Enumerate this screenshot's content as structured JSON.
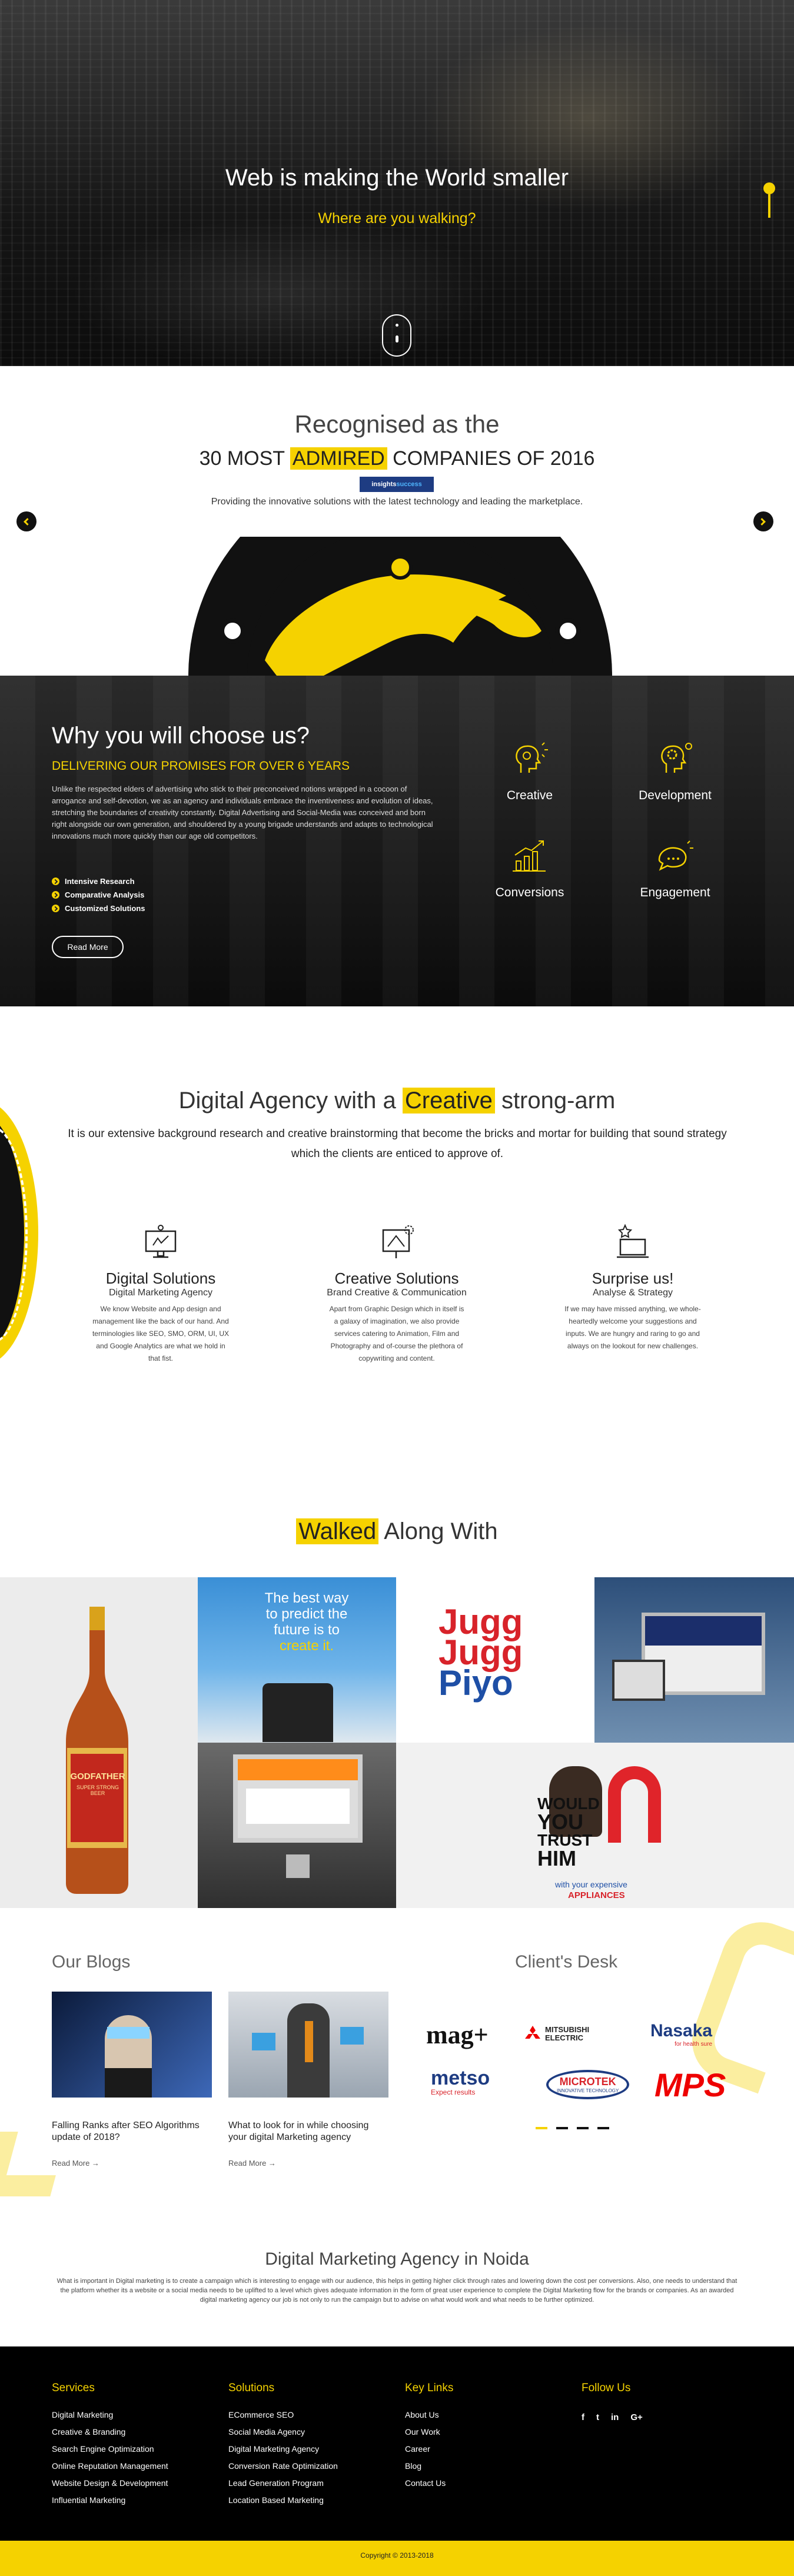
{
  "hero": {
    "title": "Web is making the World smaller",
    "subtitle": "Where are you walking?",
    "scroll_icon": "mouse-scroll-icon"
  },
  "recognition": {
    "line1": "Recognised as the",
    "pre": "30 MOST ",
    "highlight": "ADMIRED",
    "post": " COMPANIES OF 2016",
    "badge_a": "insights",
    "badge_b": "success",
    "description": "Providing the innovative solutions with the latest technology and leading the marketplace.",
    "prev_icon": "chevron-left-icon",
    "next_icon": "chevron-right-icon"
  },
  "why": {
    "title": "Why you will choose us?",
    "tagline": "DELIVERING OUR PROMISES FOR OVER 6 YEARS",
    "body": "Unlike the respected elders of advertising who stick to their preconceived notions wrapped in a cocoon of arrogance and self-devotion, we as an agency and individuals embrace the inventiveness and evolution of ideas, stretching the boundaries of creativity constantly. Digital Advertising and Social-Media was conceived and born right alongside our own generation, and shouldered by a young brigade understands and adapts to technological innovations much more quickly than our age old competitors.",
    "bullets": [
      "Intensive Research",
      "Comparative Analysis",
      "Customized Solutions"
    ],
    "button": "Read More",
    "features": [
      "Creative",
      "Development",
      "Conversions",
      "Engagement"
    ]
  },
  "agency": {
    "pre": "Digital Agency with a ",
    "highlight": "Creative",
    "post": " strong-arm",
    "description": "It is our extensive background research and creative brainstorming that become the bricks and mortar for building that sound strategy which the clients are enticed to approve of.",
    "services": [
      {
        "title": "Digital Solutions",
        "subtitle": "Digital Marketing Agency",
        "text": "We know Website and App design and management like the back of our hand. And terminologies like SEO, SMO, ORM, UI, UX and Google Analytics are what we hold in that fist."
      },
      {
        "title": "Creative Solutions",
        "subtitle": "Brand Creative & Communication",
        "text": "Apart from Graphic Design which in itself is a galaxy of imagination, we also provide services catering to Animation, Film and Photography and of-course the plethora of copywriting and content."
      },
      {
        "title": "Surprise us!",
        "subtitle": "Analyse & Strategy",
        "text": "If we may have missed anything, we whole-heartedly welcome your suggestions and inputs. We are hungry and raring to go and always on the lookout for new challenges."
      }
    ]
  },
  "walked": {
    "highlight": "Walked",
    "post": " Along With"
  },
  "portfolio": {
    "beer_label": "GODFATHER",
    "beer_sub": "SUPER STRONG BEER",
    "predict": [
      "The best way",
      "to predict the",
      "future is to",
      "create it."
    ],
    "jugg1": "Jugg",
    "jugg2": "Jugg",
    "jugg3": "Piyo",
    "would": [
      "WOULD",
      "YOU",
      "TRUST",
      "HIM"
    ],
    "with": "with your expensive",
    "appliances": "APPLIANCES"
  },
  "blogs": {
    "title": "Our Blogs",
    "posts": [
      {
        "title": "Falling Ranks after SEO Algorithms update of 2018?",
        "link": "Read More →"
      },
      {
        "title": "What to look for in while choosing your digital Marketing agency",
        "link": "Read More →"
      }
    ]
  },
  "clients": {
    "title": "Client's Desk",
    "logos": [
      "mag+",
      "MITSUBISHI ELECTRIC",
      "Nasaka",
      "metso",
      "MICROTEK",
      "MPS"
    ],
    "nasaka_sub": "for health sure",
    "metso_sub": "Expect results",
    "microtek_sub": "INNOVATIVE TECHNOLOGY"
  },
  "noida": {
    "title": "Digital Marketing Agency in Noida",
    "text": "What is important in Digital marketing is to create a campaign which is interesting to engage with our audience, this helps in getting higher click through rates and lowering down the cost per conversions. Also, one needs to understand that the platform whether its a website or a social media needs to be uplifted to a level which gives adequate information in the form of great user experience to complete the Digital Marketing flow for the brands or companies. As an awarded digital marketing agency our job is not only to run the campaign but to advise on what would work and what needs to be further optimized."
  },
  "footer": {
    "services": {
      "title": "Services",
      "items": [
        "Digital Marketing",
        "Creative & Branding",
        "Search Engine Optimization",
        "Online Reputation Management",
        "Website Design & Development",
        "Influential Marketing"
      ]
    },
    "solutions": {
      "title": "Solutions",
      "items": [
        "ECommerce SEO",
        "Social Media Agency",
        "Digital Marketing Agency",
        "Conversion Rate Optimization",
        "Lead Generation Program",
        "Location Based Marketing"
      ]
    },
    "links": {
      "title": "Key Links",
      "items": [
        "About Us",
        "Our Work",
        "Career",
        "Blog",
        "Contact Us"
      ]
    },
    "follow": {
      "title": "Follow Us",
      "icons": [
        "f",
        "t",
        "in",
        "G+"
      ]
    },
    "copyright": "Copyright © 2013-2018"
  },
  "colors": {
    "accent": "#f5d200",
    "dark": "#151515"
  }
}
